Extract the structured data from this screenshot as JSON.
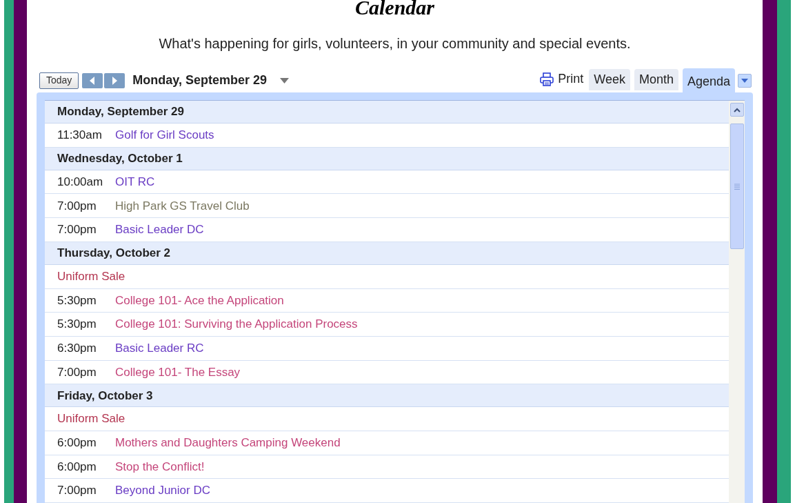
{
  "title": "Calendar",
  "subtitle": "What's happening for girls, volunteers, in your community and special events.",
  "toolbar": {
    "today": "Today",
    "date": "Monday, September 29",
    "print": "Print"
  },
  "tabs": [
    {
      "label": "Week",
      "selected": false
    },
    {
      "label": "Month",
      "selected": false
    },
    {
      "label": "Agenda",
      "selected": true
    }
  ],
  "agenda": [
    {
      "kind": "day",
      "label": "Monday, September 29"
    },
    {
      "kind": "event",
      "time": "11:30am",
      "title": "Golf for Girl Scouts",
      "color": "#6a3dc4"
    },
    {
      "kind": "day",
      "label": "Wednesday, October 1"
    },
    {
      "kind": "event",
      "time": "10:00am",
      "title": "OIT RC",
      "color": "#6a3dc4"
    },
    {
      "kind": "event",
      "time": "7:00pm",
      "title": "High Park GS Travel Club",
      "color": "#7a7760"
    },
    {
      "kind": "event",
      "time": "7:00pm",
      "title": "Basic Leader DC",
      "color": "#6a3dc4"
    },
    {
      "kind": "day",
      "label": "Thursday, October 2"
    },
    {
      "kind": "event",
      "title": "Uniform Sale",
      "color": "#b3344f"
    },
    {
      "kind": "event",
      "time": "5:30pm",
      "title": "College 101- Ace the Application",
      "color": "#c4457a"
    },
    {
      "kind": "event",
      "time": "5:30pm",
      "title": "College 101: Surviving the Application Process",
      "color": "#c4457a"
    },
    {
      "kind": "event",
      "time": "6:30pm",
      "title": "Basic Leader RC",
      "color": "#6a3dc4"
    },
    {
      "kind": "event",
      "time": "7:00pm",
      "title": "College 101- The Essay",
      "color": "#c4457a"
    },
    {
      "kind": "day",
      "label": "Friday, October 3"
    },
    {
      "kind": "event",
      "title": "Uniform Sale",
      "color": "#b3344f"
    },
    {
      "kind": "event",
      "time": "6:00pm",
      "title": "Mothers and Daughters Camping Weekend",
      "color": "#c4457a"
    },
    {
      "kind": "event",
      "time": "6:00pm",
      "title": "Stop the Conflict!",
      "color": "#c4457a"
    },
    {
      "kind": "event",
      "time": "7:00pm",
      "title": "Beyond Junior DC",
      "color": "#6a3dc4"
    }
  ]
}
